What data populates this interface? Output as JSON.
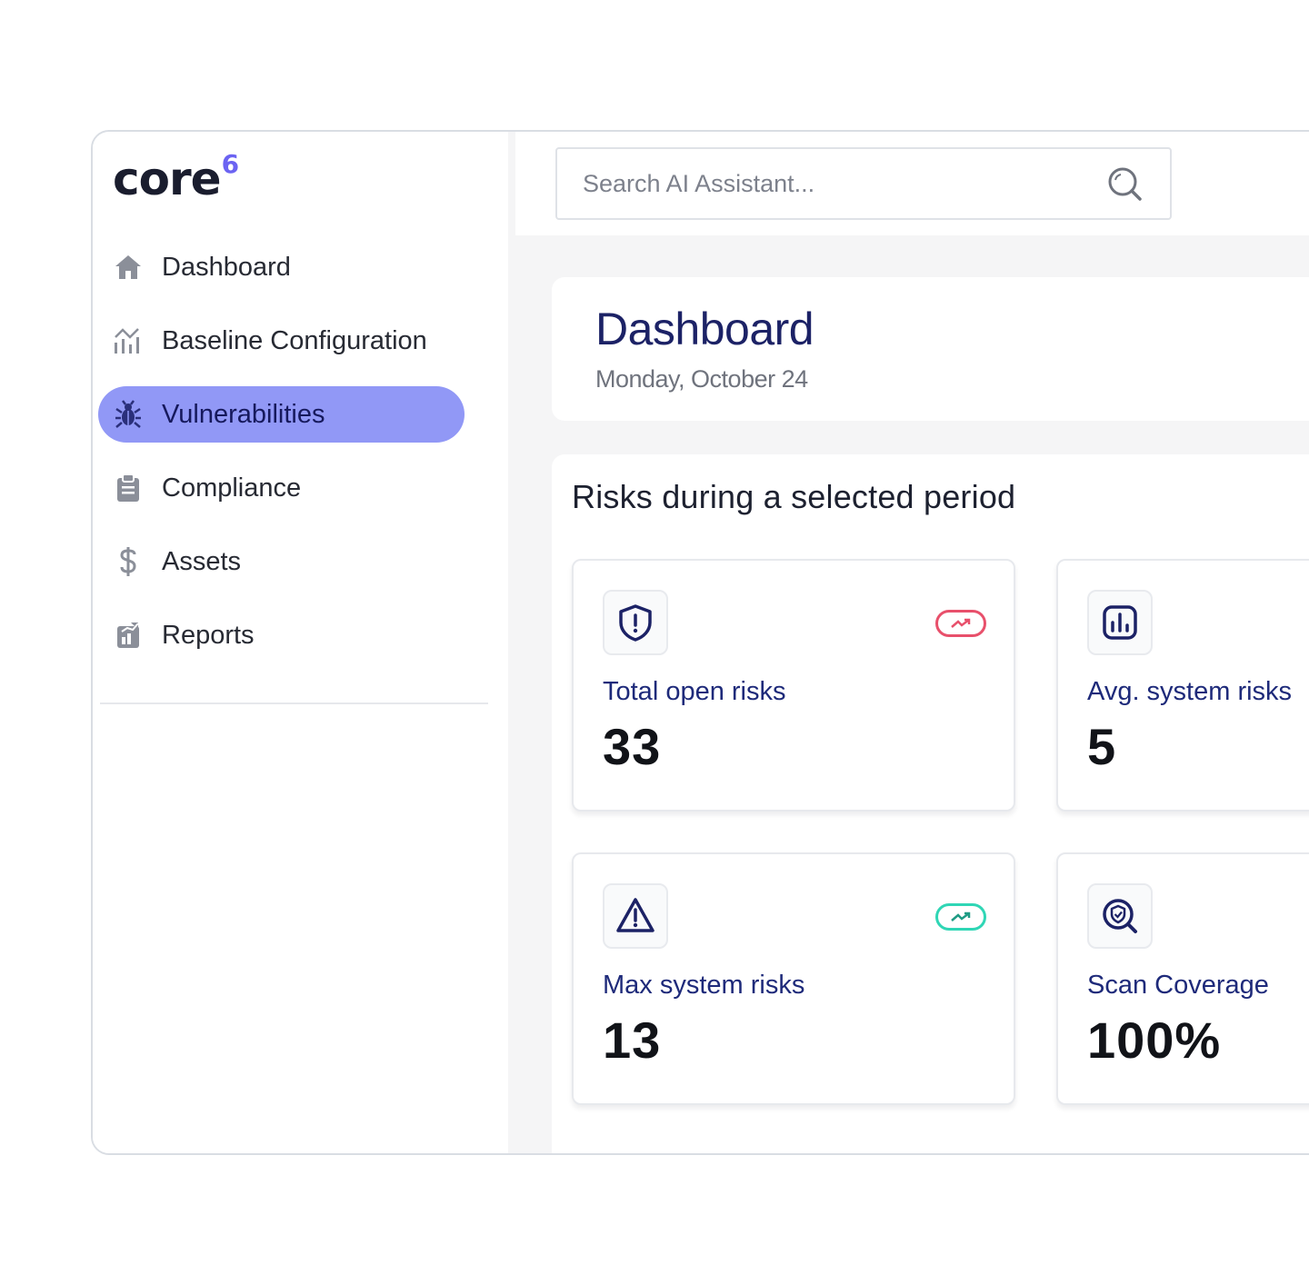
{
  "brand": {
    "name": "core",
    "superscript": "6",
    "accent_color": "#6b63f2"
  },
  "sidebar": {
    "active_color": "#9198f6",
    "items": [
      {
        "label": "Dashboard",
        "icon": "home-icon"
      },
      {
        "label": "Baseline Configuration",
        "icon": "chart-icon"
      },
      {
        "label": "Vulnerabilities",
        "icon": "bug-icon",
        "active": true
      },
      {
        "label": "Compliance",
        "icon": "clipboard-icon"
      },
      {
        "label": "Assets",
        "icon": "dollar-icon"
      },
      {
        "label": "Reports",
        "icon": "report-icon"
      }
    ]
  },
  "search": {
    "placeholder": "Search AI Assistant...",
    "icon": "search-icon"
  },
  "header": {
    "title": "Dashboard",
    "date": "Monday, October 24"
  },
  "risks": {
    "title": "Risks during a selected period",
    "metrics": [
      {
        "label": "Total open risks",
        "value": "33",
        "icon": "shield-alert-icon",
        "trend": "up",
        "trend_color": "#e8506b"
      },
      {
        "label": "Avg. system risks",
        "value": "5",
        "icon": "bar-chart-icon"
      },
      {
        "label": "Max system risks",
        "value": "13",
        "icon": "warning-triangle-icon",
        "trend": "up",
        "trend_color": "#2fd6b5"
      },
      {
        "label": "Scan Coverage",
        "value": "100%",
        "icon": "scan-shield-icon"
      }
    ]
  }
}
